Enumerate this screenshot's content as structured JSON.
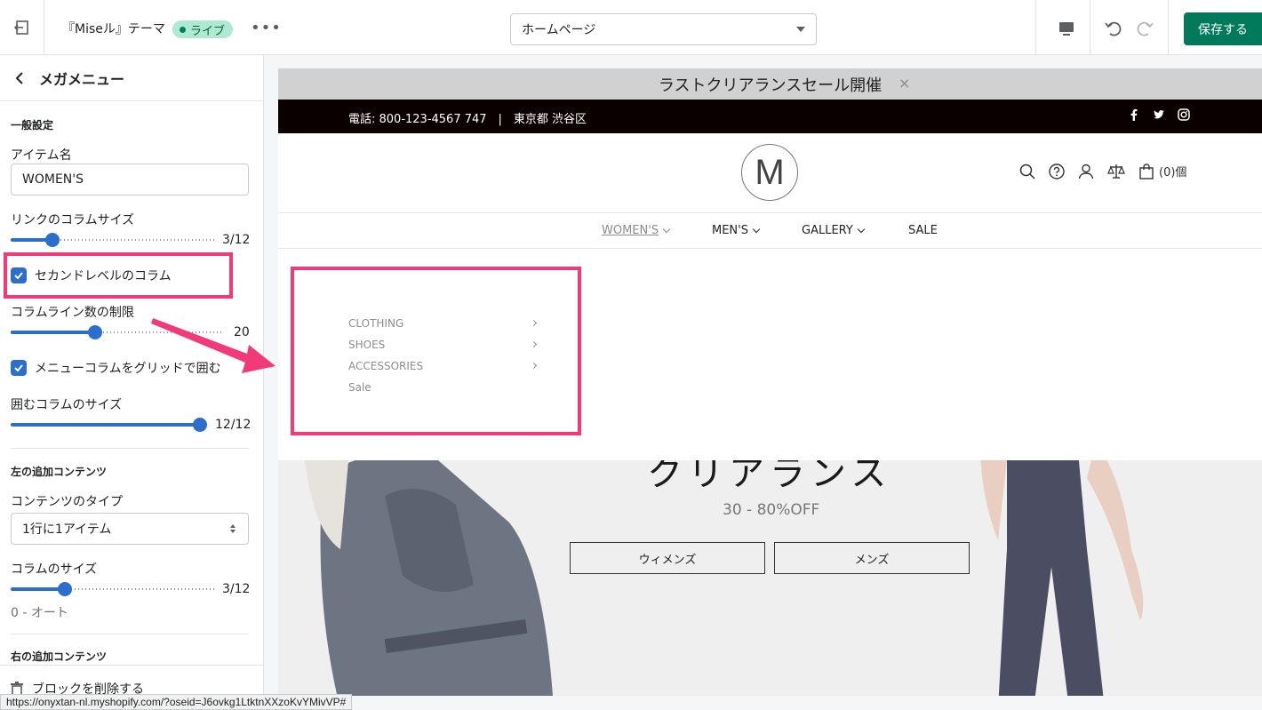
{
  "topbar": {
    "theme_name": "『Miseル』テーマ",
    "live_label": "ライブ",
    "more_label": "•••",
    "page_select": "ホームページ",
    "save_label": "保存する"
  },
  "sidebar": {
    "title": "メガメニュー",
    "general_section": "一般設定",
    "item_name_label": "アイテム名",
    "item_name_value": "WOMEN'S",
    "link_column_size_label": "リンクのコラムサイズ",
    "link_column_size_value": "3/12",
    "link_column_size_fraction": 0.25,
    "second_level_label": "セカンドレベルのコラム",
    "column_line_limit_label": "コラムライン数の制限",
    "column_line_limit_value": "20",
    "column_line_limit_fraction": 0.39,
    "grid_wrap_label": "メニューコラムをグリッドで囲む",
    "wrap_column_size_label": "囲むコラムのサイズ",
    "wrap_column_size_value": "12/12",
    "wrap_column_size_fraction": 1.0,
    "left_extra_section": "左の追加コンテンツ",
    "content_type_label": "コンテンツのタイプ",
    "content_type_value": "1行に1アイテム",
    "column_size_label": "コラムのサイズ",
    "column_size_value": "3/12",
    "column_size_fraction": 0.25,
    "auto_hint": "0 - オート",
    "right_extra_section": "右の追加コンテンツ",
    "delete_block_label": "ブロックを削除する"
  },
  "status_url": "https://onyxtan-nl.myshopify.com/?oseid=J6ovkg1LtktnXXzoKvYMivVP#",
  "preview": {
    "announcement": "ラストクリアランスセール開催",
    "close_glyph": "×",
    "contact": "電話: 800-123-4567 747　|　東京都 渋谷区",
    "logo_letter": "M",
    "cart_count": "(0)個",
    "nav": [
      {
        "label": "WOMEN'S"
      },
      {
        "label": "MEN'S"
      },
      {
        "label": "GALLERY"
      },
      {
        "label": "SALE"
      }
    ],
    "mega_items": [
      {
        "label": "CLOTHING"
      },
      {
        "label": "SHOES"
      },
      {
        "label": "ACCESSORIES"
      },
      {
        "label": "Sale"
      }
    ],
    "hero_title": "クリアランス",
    "hero_sub": "30 - 80%OFF",
    "hero_btn_women": "ウィメンズ",
    "hero_btn_men": "メンズ"
  },
  "colors": {
    "save_button": "#007a5a",
    "accent": "#2c6ecb",
    "highlight": "#f33a78",
    "infobar": "#0b0000"
  }
}
